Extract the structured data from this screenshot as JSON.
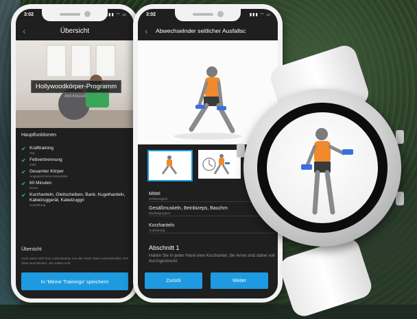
{
  "phone1": {
    "status_time": "3:02",
    "nav_title": "Übersicht",
    "program_title": "Hollywoodkörper-Programm",
    "program_level": "ANFÄNGER",
    "section_features": "Hauptfunktionen",
    "features": [
      {
        "main": "Krafttraining",
        "sub": "Typ"
      },
      {
        "main": "Fettverbrennung",
        "sub": "Ziele"
      },
      {
        "main": "Gesamter Körper",
        "sub": "Angesprochene Körperteile"
      },
      {
        "main": "60 Minuten",
        "sub": "Dauer"
      },
      {
        "main": "Kurzhanteln, Gleitscheiben, Bank, Kugelhanteln, Kabelzuggerät, Kabelzuggri",
        "sub": "Ausrüstung"
      }
    ],
    "section_overview": "Übersicht",
    "overview_text": "Auch wenn sich Ihre Lebensweise von der eines Stars unterscheidet, Ihre Ziele sind ähnlich: Sie wollen schl",
    "save_button": "In 'Meine Trainings' speichern"
  },
  "phone2": {
    "status_time": "3:02",
    "nav_title": "Abwechselnder seitlicher Ausfallsc",
    "fields": [
      {
        "value": "Mittel",
        "label": "Schwierigkeit"
      },
      {
        "value": "Gesäßmuskeln, Beinbizeps, Bauchm",
        "label": "Muskelgruppen"
      },
      {
        "value": "Kurzhanteln",
        "label": "Ausrüstung"
      }
    ],
    "section_title": "Abschnitt 1",
    "section_text": "Halten Sie in jeder Hand eine Kurzhantel, die Arme sind dabei voll durchgestreckt",
    "back_button": "Zurück",
    "next_button": "Weiter"
  },
  "colors": {
    "accent": "#1e9be0",
    "check": "#33c46a",
    "shirt": "#f08a2a",
    "dumbbell": "#3b6fe0"
  }
}
